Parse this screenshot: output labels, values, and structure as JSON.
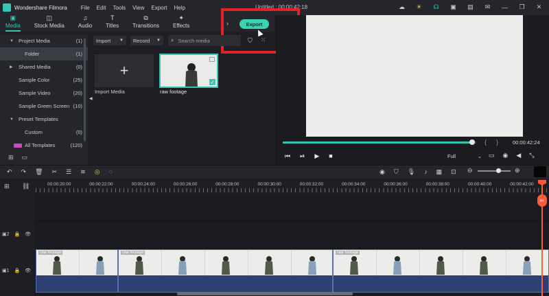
{
  "app": {
    "name": "Wondershare Filmora",
    "document_title": "Untitled : 00:00:42:18",
    "menu": [
      "File",
      "Edit",
      "Tools",
      "View",
      "Export",
      "Help"
    ]
  },
  "tabs": [
    {
      "label": "Media",
      "icon": "folder-icon",
      "active": true
    },
    {
      "label": "Stock Media",
      "icon": "stock-icon",
      "active": false
    },
    {
      "label": "Audio",
      "icon": "music-note-icon",
      "active": false
    },
    {
      "label": "Titles",
      "icon": "text-t-icon",
      "active": false
    },
    {
      "label": "Transitions",
      "icon": "transitions-icon",
      "active": false
    },
    {
      "label": "Effects",
      "icon": "effects-icon",
      "active": false
    }
  ],
  "export_button": {
    "label": "Export"
  },
  "sidebar": {
    "items": [
      {
        "label": "Project Media",
        "count": "(1)",
        "expandable": true
      },
      {
        "label": "Folder",
        "count": "(1)",
        "selected": true
      },
      {
        "label": "Shared Media",
        "count": "(0)",
        "expandable": true
      },
      {
        "label": "Sample Color",
        "count": "(25)"
      },
      {
        "label": "Sample Video",
        "count": "(20)"
      },
      {
        "label": "Sample Green Screen",
        "count": "(10)"
      },
      {
        "label": "Preset Templates",
        "count": "",
        "expandable": true
      },
      {
        "label": "Custom",
        "count": "(0)"
      },
      {
        "label": "All Templates",
        "count": "(120)"
      }
    ]
  },
  "media_toolbar": {
    "import_label": "Import",
    "record_label": "Record",
    "search_placeholder": "Search media"
  },
  "media_items": [
    {
      "label": "Import Media"
    },
    {
      "label": "raw footage"
    }
  ],
  "preview": {
    "timecode": "00:00:42:24",
    "quality": "Full",
    "progress_fraction": 0.98
  },
  "timeline": {
    "ruler_labels": [
      "00:00:20:00",
      "00:00:22:00",
      "00:00:24:00",
      "00:00:26:00",
      "00:00:28:00",
      "00:00:30:00",
      "00:00:32:00",
      "00:00:34:00",
      "00:00:36:00",
      "00:00:38:00",
      "00:00:40:00",
      "00:00:42:00"
    ],
    "tracks": [
      {
        "label": "2"
      },
      {
        "label": "1"
      }
    ],
    "clips": [
      {
        "name": "raw footage"
      },
      {
        "name": "raw footage"
      },
      {
        "name": "raw footage"
      }
    ],
    "zoom_fraction": 0.62
  },
  "colors": {
    "accent": "#37c6b3",
    "highlight_box": "#e02424",
    "playhead": "#ff5a3c",
    "clip": "#32457c"
  }
}
